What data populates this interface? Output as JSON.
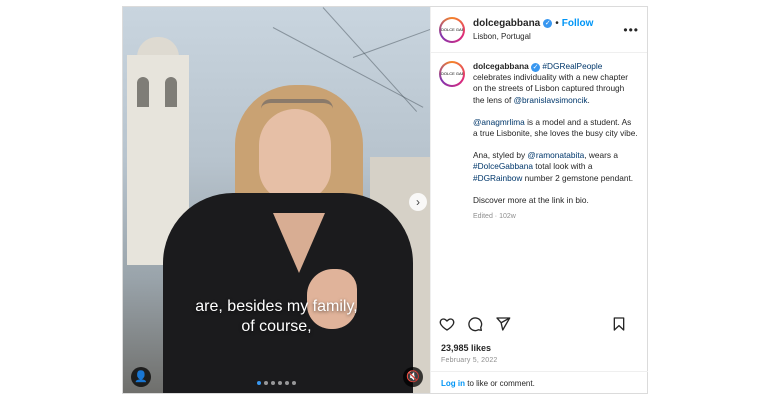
{
  "post": {
    "media": {
      "subtitle_line1": "are, besides my family,",
      "subtitle_line2": "of course,",
      "next_glyph": "›",
      "tag_glyph": "👤",
      "mute_glyph": "🔇",
      "slide_count": 6,
      "active_slide": 0
    },
    "header": {
      "avatar_text": "DOLCE GABBANA",
      "username": "dolcegabbana",
      "verified_glyph": "✓",
      "separator": "•",
      "follow_label": "Follow",
      "location": "Lisbon, Portugal",
      "more_glyph": "•••"
    },
    "caption": {
      "avatar_text": "DOLCE GABBANA",
      "username": "dolcegabbana",
      "verified_glyph": "✓",
      "hashtag_dgrealpeople": "#DGRealPeople",
      "p1_text": "celebrates individuality with a new chapter on the streets of Lisbon captured through the lens of",
      "photographer": "@branislavsimoncik",
      "p1_end": ".",
      "model_handle": "@anagmrlima",
      "p2_text": " is a model and a student. As a true Lisbonite, she loves the busy city vibe.",
      "p3_start": "Ana, styled by ",
      "stylist": "@ramonatabita",
      "p3_mid1": ", wears a ",
      "hashtag_dolcegabbana": "#DolceGabbana",
      "p3_mid2": " total look with a ",
      "hashtag_dgrainbow": "#DGRainbow",
      "p3_end": " number 2 gemstone pendant.",
      "p4_text": "Discover more at the link in bio.",
      "edited": "Edited · 102w"
    },
    "stats": {
      "likes": "23,985 likes",
      "date": "February 5, 2022"
    },
    "login": {
      "link_label": "Log in",
      "rest": " to like or comment."
    }
  },
  "colors": {
    "link_blue": "#0095f6",
    "verified_blue": "#3897f0",
    "mention_navy": "#00376b"
  }
}
